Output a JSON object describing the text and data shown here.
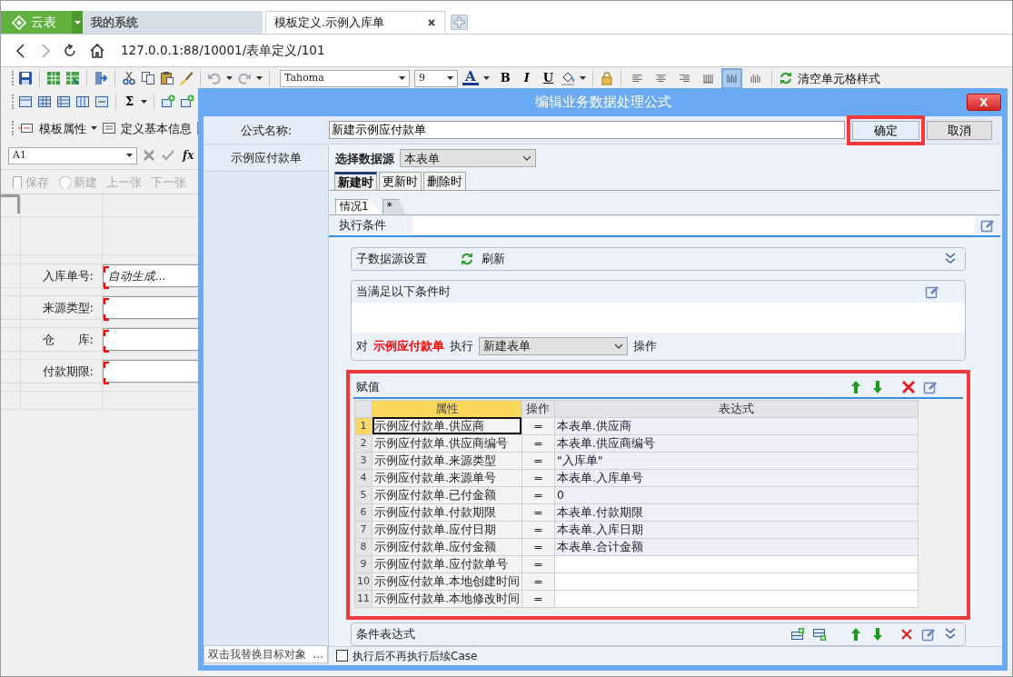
{
  "browser": {
    "tabs": [
      {
        "label": "云表",
        "kind": "brand"
      },
      {
        "label": "我的系统",
        "kind": "page",
        "selected": false
      },
      {
        "label": "模板定义.示例入库单",
        "kind": "page",
        "selected": true
      }
    ],
    "url": "127.0.0.1:88/10001/表单定义/101"
  },
  "toolbar": {
    "font": "Tahoma",
    "font_size": "9",
    "font_color": "A",
    "styles": [
      "B",
      "I",
      "U"
    ],
    "align_buttons": [
      {
        "selected": false
      },
      {
        "selected": false
      },
      {
        "selected": false
      },
      {
        "selected": false
      },
      {
        "selected": true
      },
      {
        "selected": false
      }
    ],
    "clear_style": "清空单元格样式"
  },
  "toolbar2": {
    "sum": "Σ"
  },
  "toolbar3": {
    "template_props": "模板属性",
    "basic_info": "定义基本信息"
  },
  "formula_bar": {
    "cell": "A1",
    "fx": "fx"
  },
  "record_bar": [
    {
      "label": "保存",
      "disabled": true
    },
    {
      "label": "新建",
      "disabled": true
    },
    {
      "label": "上一张",
      "disabled": true
    },
    {
      "label": "下一张",
      "disabled": true
    }
  ],
  "form_fields": [
    {
      "label": "入库单号:",
      "placeholder": "自动生成...",
      "required": true
    },
    {
      "label": "来源类型:",
      "required": true
    },
    {
      "label": "仓　　库:",
      "required": true
    },
    {
      "label": "付款期限:",
      "required": true
    }
  ],
  "dialog": {
    "title": "编辑业务数据处理公式",
    "close": "X",
    "name_label": "公式名称:",
    "name_value": "新建示例应付款单",
    "ok": {
      "label": "确定",
      "highlighted": true
    },
    "cancel": "取消",
    "targets": [
      {
        "label": "示例应付款单"
      }
    ],
    "replace_hint": "双击我替换目标对象",
    "replace_more": "...",
    "source_label": "选择数据源",
    "source_value": "本表单",
    "event_tabs": [
      {
        "label": "新建时",
        "selected": true
      },
      {
        "label": "更新时",
        "selected": false
      },
      {
        "label": "删除时",
        "selected": false
      }
    ],
    "case_tabs": [
      {
        "label": "情况1",
        "selected": true
      },
      {
        "label": "*",
        "selected": false
      }
    ],
    "exec_condition": "执行条件",
    "sub_source": "子数据源设置",
    "refresh": "刷新",
    "when_label": "当满足以下条件时",
    "action": {
      "pre": "对",
      "target": "示例应付款单",
      "mid": "执行",
      "op": "新建表单",
      "post": "操作"
    },
    "assign": {
      "title": "赋值",
      "highlighted": true,
      "columns": [
        "属性",
        "操作",
        "表达式"
      ],
      "rows": [
        {
          "num": "1",
          "prop": "示例应付款单.供应商",
          "op": "=",
          "expr": "本表单.供应商",
          "selected": true
        },
        {
          "num": "2",
          "prop": "示例应付款单.供应商编号",
          "op": "=",
          "expr": "本表单.供应商编号",
          "selected": false
        },
        {
          "num": "3",
          "prop": "示例应付款单.来源类型",
          "op": "=",
          "expr": "\"入库单\"",
          "selected": false
        },
        {
          "num": "4",
          "prop": "示例应付款单.来源单号",
          "op": "=",
          "expr": "本表单.入库单号",
          "selected": false
        },
        {
          "num": "5",
          "prop": "示例应付款单.已付金额",
          "op": "=",
          "expr": "0",
          "selected": false
        },
        {
          "num": "6",
          "prop": "示例应付款单.付款期限",
          "op": "=",
          "expr": "本表单.付款期限",
          "selected": false
        },
        {
          "num": "7",
          "prop": "示例应付款单.应付日期",
          "op": "=",
          "expr": "本表单.入库日期",
          "selected": false
        },
        {
          "num": "8",
          "prop": "示例应付款单.应付金额",
          "op": "=",
          "expr": "本表单.合计金额",
          "selected": false
        },
        {
          "num": "9",
          "prop": "示例应付款单.应付款单号",
          "op": "=",
          "selected": false
        },
        {
          "num": "10",
          "prop": "示例应付款单.本地创建时间",
          "op": "=",
          "selected": false
        },
        {
          "num": "11",
          "prop": "示例应付款单.本地修改时间",
          "op": "=",
          "selected": false
        }
      ]
    },
    "cond_expr": "条件表达式",
    "stop_case": {
      "label": "执行后不再执行后续Case",
      "checked": false
    }
  }
}
